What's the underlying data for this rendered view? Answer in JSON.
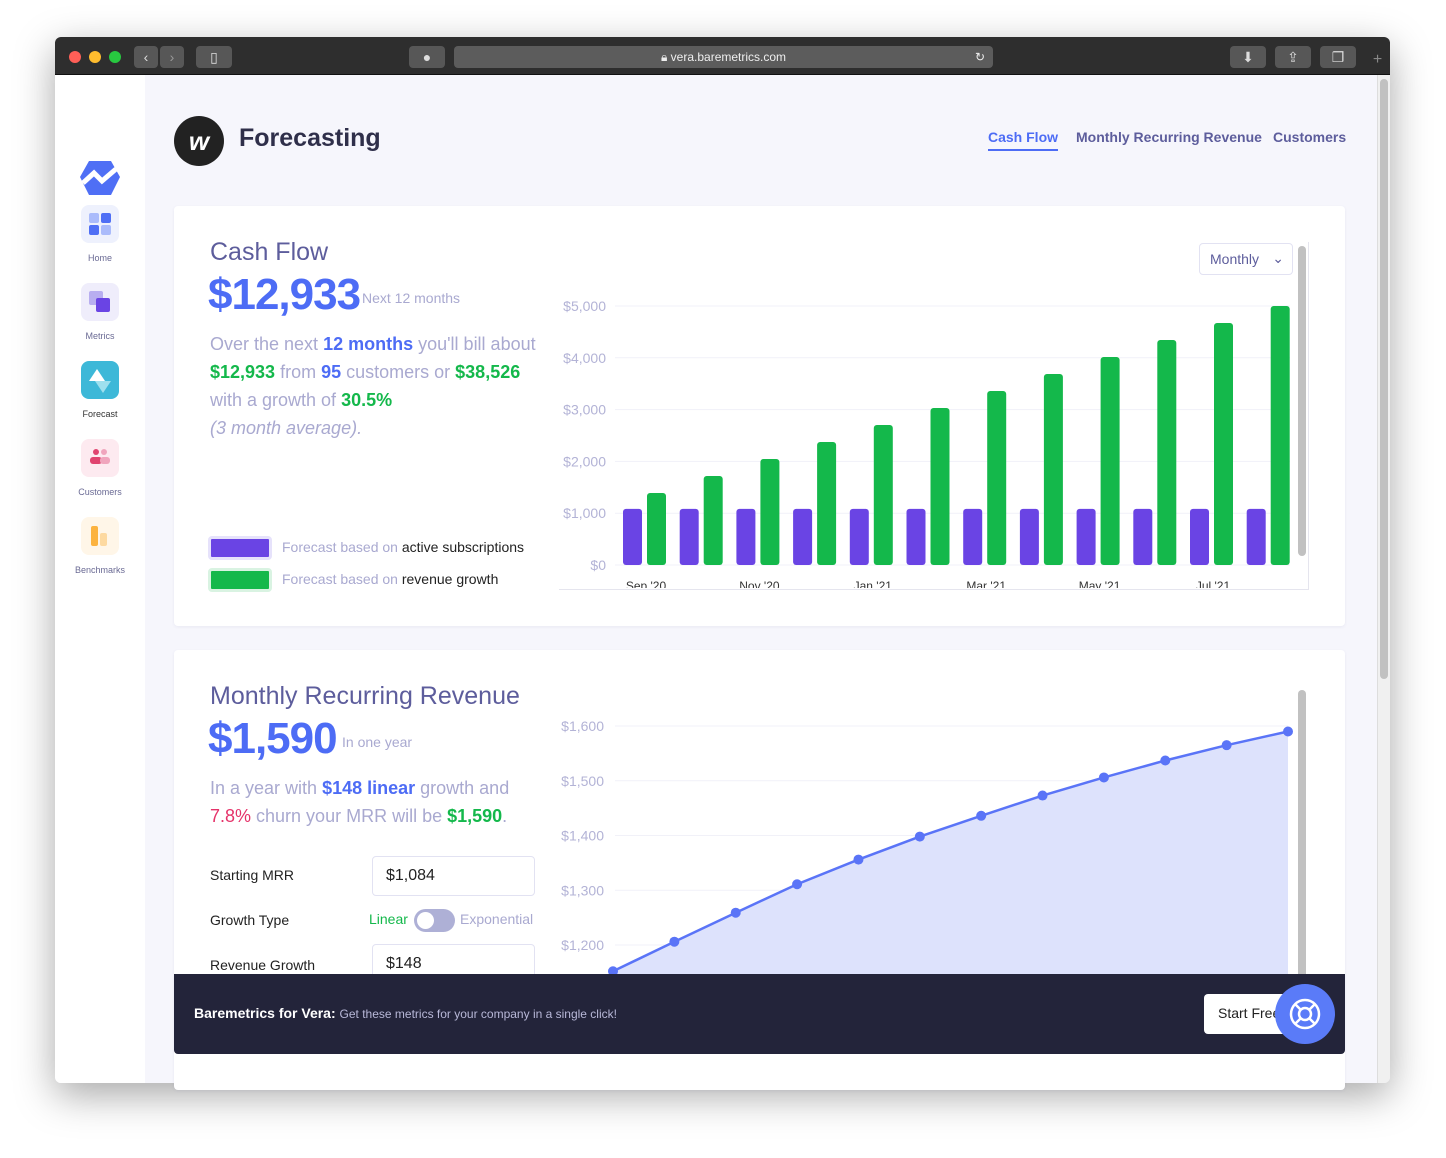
{
  "browser": {
    "url": "vera.baremetrics.com"
  },
  "sidebar": {
    "items": [
      {
        "label": "Home"
      },
      {
        "label": "Metrics"
      },
      {
        "label": "Forecast"
      },
      {
        "label": "Customers"
      },
      {
        "label": "Benchmarks"
      }
    ]
  },
  "header": {
    "avatar_letter": "w",
    "title": "Forecasting",
    "tabs": [
      {
        "label": "Cash Flow",
        "active": true
      },
      {
        "label": "Monthly Recurring Revenue"
      },
      {
        "label": "Customers"
      }
    ]
  },
  "cashflow": {
    "title": "Cash Flow",
    "amount": "$12,933",
    "period": "Next 12 months",
    "sentence": {
      "p1": "Over the next ",
      "months": "12 months",
      "p2": " you'll bill about",
      "amount": "$12,933",
      "p3": " from ",
      "customers": "95",
      "p4": " customers or ",
      "growth_amount": "$38,526",
      "p5": "with a growth of ",
      "growth": "30.5%",
      "p6": "(3 month average)."
    },
    "legend": [
      {
        "prefix": "Forecast based on ",
        "label": "active subscriptions",
        "color": "#6a44e4"
      },
      {
        "prefix": "Forecast based on ",
        "label": "revenue growth",
        "color": "#14b84b"
      }
    ],
    "dropdown": "Monthly"
  },
  "mrr": {
    "title": "Monthly Recurring Revenue",
    "amount": "$1,590",
    "period": "In one year",
    "sentence": {
      "p1": "In a year with ",
      "growth": "$148 linear",
      "p2": " growth and",
      "churn": "7.8%",
      "p3": " churn your MRR will be ",
      "result": "$1,590",
      "p4": "."
    },
    "form": {
      "starting_label": "Starting MRR",
      "starting_value": "$1,084",
      "growth_type_label": "Growth Type",
      "linear": "Linear",
      "exponential": "Exponential",
      "growth_type": "Linear",
      "revenue_label": "Revenue Growth",
      "revenue_value": "$148"
    }
  },
  "banner": {
    "bold": "Baremetrics for Vera:",
    "text": "Get these metrics for your company in a single click!",
    "button": "Start Free"
  },
  "chart_data": [
    {
      "type": "bar",
      "ylim": [
        0,
        5000
      ],
      "yticks": [
        "$0",
        "$1,000",
        "$2,000",
        "$3,000",
        "$4,000",
        "$5,000"
      ],
      "xticks": [
        "Sep '20",
        "Nov '20",
        "Jan '21",
        "Mar '21",
        "May '21",
        "Jul '21"
      ],
      "series": [
        {
          "name": "active subscriptions",
          "color": "#6a44e4",
          "values": [
            1084,
            1084,
            1084,
            1084,
            1084,
            1084,
            1084,
            1084,
            1084,
            1084,
            1084,
            1084
          ]
        },
        {
          "name": "revenue growth",
          "color": "#14b84b",
          "values": [
            1390,
            1718,
            2046,
            2375,
            2703,
            3031,
            3359,
            3687,
            4015,
            4344,
            4672,
            5000
          ]
        }
      ]
    },
    {
      "type": "area",
      "ylim": [
        1150,
        1650
      ],
      "yticks": [
        "$1,200",
        "$1,300",
        "$1,400",
        "$1,500",
        "$1,600"
      ],
      "color": "#5a74f7",
      "values": [
        1152,
        1206,
        1259,
        1311,
        1356,
        1398,
        1436,
        1473,
        1506,
        1537,
        1565,
        1590
      ]
    }
  ]
}
